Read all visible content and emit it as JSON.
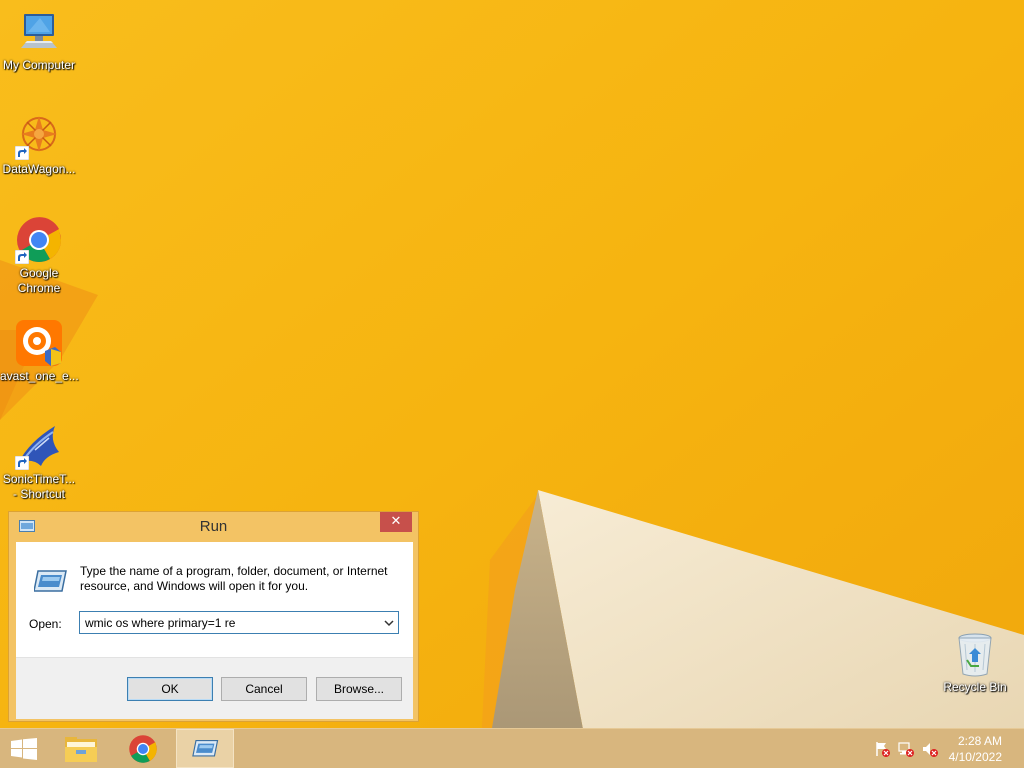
{
  "desktop": {
    "icons": [
      {
        "label": "My Computer",
        "icon": "my-computer-icon"
      },
      {
        "label": "DataWagon...",
        "icon": "datawagon-icon"
      },
      {
        "label": "Google Chrome",
        "icon": "chrome-icon"
      },
      {
        "label": "avast_one_e...",
        "icon": "avast-icon"
      },
      {
        "label": "SonicTimeT... - Shortcut",
        "icon": "sonictime-icon"
      },
      {
        "label": "Recycle Bin",
        "icon": "recycle-bin-icon"
      }
    ]
  },
  "run_dialog": {
    "title": "Run",
    "close_label": "✕",
    "description": "Type the name of a program, folder, document, or Internet resource, and Windows will open it for you.",
    "open_label": "Open:",
    "input_value": "wmic os where primary=1 re",
    "buttons": {
      "ok": "OK",
      "cancel": "Cancel",
      "browse": "Browse..."
    }
  },
  "taskbar": {
    "items": [
      {
        "name": "start-button",
        "icon": "windows-logo-icon"
      },
      {
        "name": "file-explorer",
        "icon": "folder-icon"
      },
      {
        "name": "google-chrome",
        "icon": "chrome-icon"
      },
      {
        "name": "run-window",
        "icon": "run-icon",
        "active": true
      }
    ],
    "tray": [
      "action-center-flag-icon",
      "network-icon",
      "volume-muted-icon"
    ],
    "clock": {
      "time": "2:28 AM",
      "date": "4/10/2022"
    }
  },
  "colors": {
    "wallpaper": "#f7b112",
    "dialog_frame": "#f3c364",
    "close_button": "#c7504b",
    "taskbar": "#d8b67e",
    "focus_border": "#3c7fb1"
  }
}
